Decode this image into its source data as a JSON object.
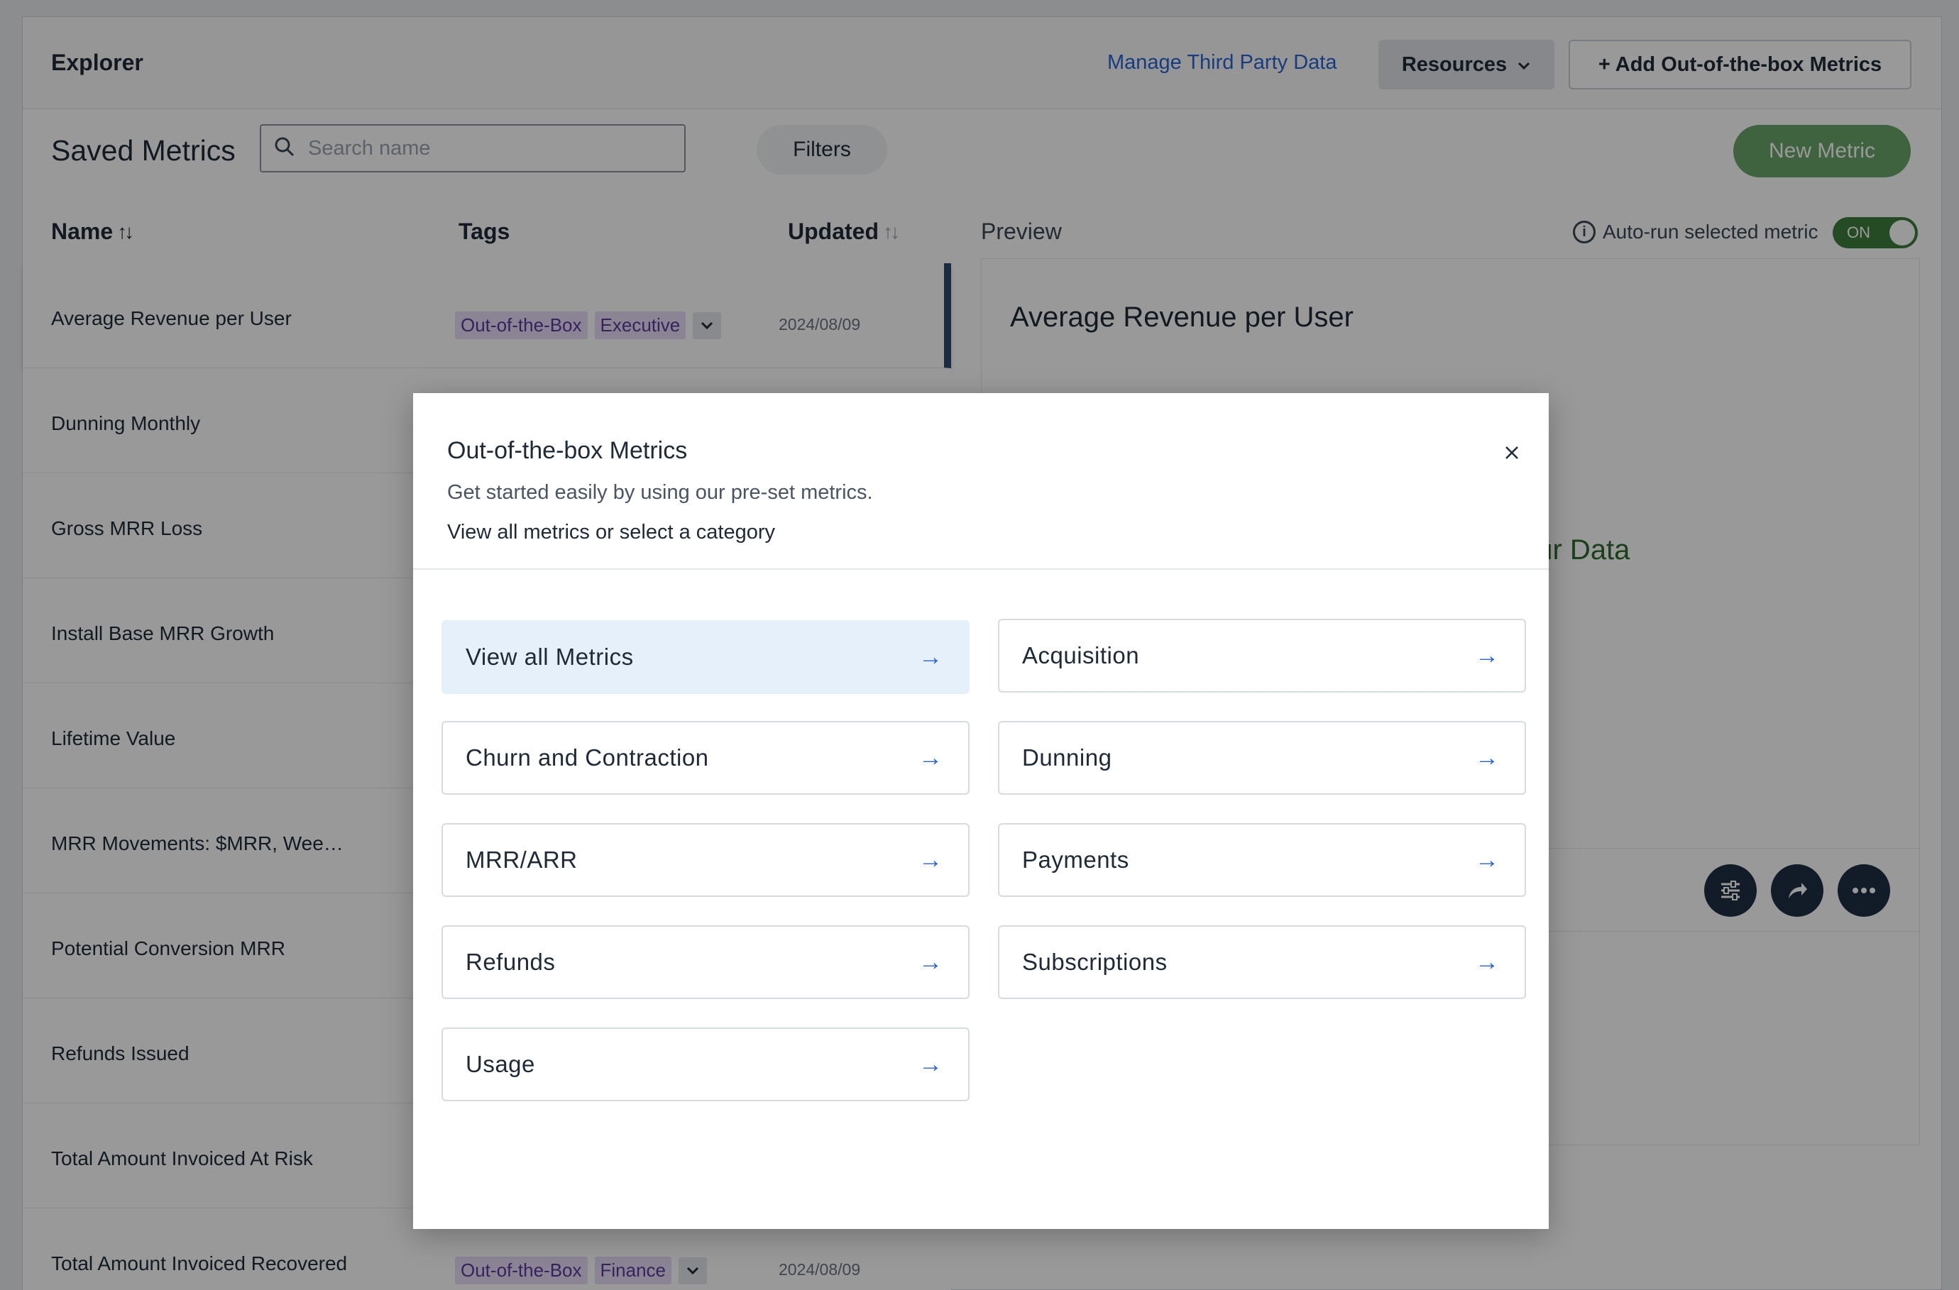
{
  "topbar": {
    "title": "Explorer",
    "manage_link": "Manage Third Party Data",
    "resources_label": "Resources",
    "add_button": "+ Add Out-of-the-box Metrics"
  },
  "toolbar": {
    "saved_title": "Saved Metrics",
    "search_placeholder": "Search name",
    "filters_label": "Filters",
    "new_metric_label": "New Metric"
  },
  "table": {
    "columns": {
      "name": "Name",
      "tags": "Tags",
      "updated": "Updated"
    },
    "rows": [
      {
        "name": "Average Revenue per User",
        "tags": [
          "Out-of-the-Box",
          "Executive"
        ],
        "date": "2024/08/09",
        "selected": true
      },
      {
        "name": "Dunning Monthly",
        "tags": [],
        "date": ""
      },
      {
        "name": "Gross MRR Loss",
        "tags": [],
        "date": ""
      },
      {
        "name": "Install Base MRR Growth",
        "tags": [],
        "date": ""
      },
      {
        "name": "Lifetime Value",
        "tags": [],
        "date": ""
      },
      {
        "name": "MRR Movements: $MRR, Wee…",
        "tags": [],
        "date": ""
      },
      {
        "name": "Potential Conversion MRR",
        "tags": [],
        "date": ""
      },
      {
        "name": "Refunds Issued",
        "tags": [],
        "date": ""
      },
      {
        "name": "Total Amount Invoiced At Risk",
        "tags": [],
        "date": ""
      },
      {
        "name": "Total Amount Invoiced Recovered",
        "tags": [
          "Out-of-the-Box",
          "Finance"
        ],
        "date": "2024/08/09"
      }
    ]
  },
  "preview": {
    "label": "Preview",
    "autorun_label": "Auto-run selected metric",
    "toggle_label": "ON",
    "title": "Average Revenue per User",
    "background_text": "our Data"
  },
  "modal": {
    "title": "Out-of-the-box Metrics",
    "subtitle": "Get started easily by using our pre-set metrics.",
    "prompt": "View all metrics or select a category",
    "categories": [
      {
        "label": "View all Metrics"
      },
      {
        "label": "Acquisition"
      },
      {
        "label": "Churn and Contraction"
      },
      {
        "label": "Dunning"
      },
      {
        "label": "MRR/ARR"
      },
      {
        "label": "Payments"
      },
      {
        "label": "Refunds"
      },
      {
        "label": "Subscriptions"
      },
      {
        "label": "Usage"
      }
    ]
  },
  "colors": {
    "accent_link": "#2a63d4",
    "primary_green": "#6ba56a",
    "tag_bg": "#e8dcf7",
    "active_category_bg": "#e6f0fb"
  }
}
